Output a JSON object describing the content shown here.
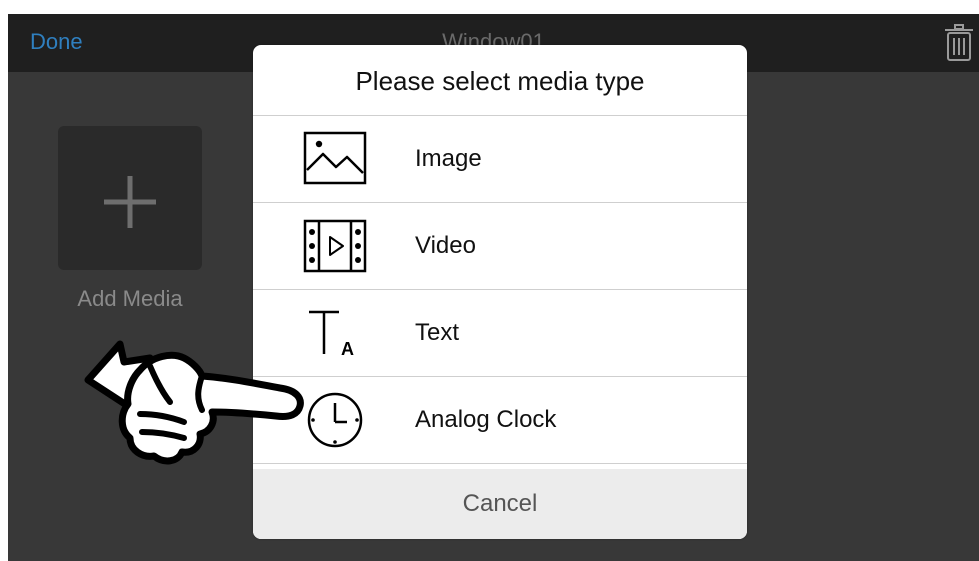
{
  "header": {
    "done_label": "Done",
    "title": "Window01",
    "trash_icon": "trash-icon"
  },
  "add_media": {
    "label": "Add Media",
    "icon": "plus-icon"
  },
  "dialog": {
    "title": "Please select media type",
    "options": [
      {
        "label": "Image",
        "icon": "image-icon"
      },
      {
        "label": "Video",
        "icon": "video-icon"
      },
      {
        "label": "Text",
        "icon": "text-icon"
      },
      {
        "label": "Analog Clock",
        "icon": "clock-icon"
      }
    ],
    "cancel_label": "Cancel"
  },
  "overlay": {
    "icon": "pointing-hand-icon"
  },
  "colors": {
    "accent": "#2f7fbf",
    "background": "#383838",
    "topbar": "#1f1f1f"
  }
}
